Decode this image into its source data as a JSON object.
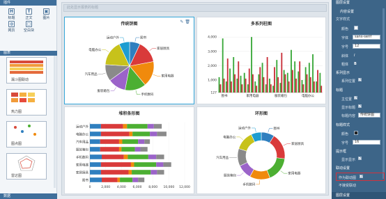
{
  "left_panel": {
    "top_label": "插件",
    "tools": [
      {
        "label": "标题",
        "icon": "H"
      },
      {
        "label": "正文",
        "icon": "T"
      },
      {
        "label": "图片",
        "icon": "▣"
      },
      {
        "label": "网页",
        "icon": "◍"
      },
      {
        "label": "空白块",
        "icon": "□"
      }
    ],
    "section_label": "图表",
    "thumbs": [
      "漏斗图联动",
      "热力图",
      "图点图",
      "雷达图"
    ],
    "bottom_label": "数据"
  },
  "canvas": {
    "title_placeholder": "此处显示报表的标题"
  },
  "right_panel": {
    "header": "图层设置",
    "tab": "内容设置",
    "section_text": "文字样式",
    "labels": {
      "color": "颜色",
      "font": "字体",
      "size": "字号",
      "italic": "斜体",
      "bold": "粗体",
      "series_show": "系列显示",
      "series_check": "系列位置",
      "title": "标题",
      "title_pos": "主位置",
      "title_show": "显示标题",
      "title_content": "标题内容",
      "legend_style": "标题样式",
      "legend_color": "颜色",
      "legend_size": "字号",
      "tooltip": "提示框",
      "tooltip_show": "显示显示",
      "link": "联动设置",
      "as_link": "作为联动图",
      "not_linked": "不接受联动"
    },
    "values": {
      "font": "sans-serif",
      "size": "12",
      "italic": "I",
      "bold": "B",
      "title_content": "传统饼图",
      "legend_size": "16"
    },
    "bottom": "图层设置"
  },
  "chart_data": [
    {
      "type": "pie",
      "title": "传统饼图",
      "categories": [
        "图书",
        "家居厨具",
        "家用电器",
        "手机数码",
        "服装箱包",
        "汽车用品",
        "电脑办公",
        "运动户外"
      ],
      "values": [
        7,
        15,
        17,
        14,
        12,
        11,
        17,
        7
      ],
      "colors": [
        "#2f7fbf",
        "#d93a3a",
        "#f08a0c",
        "#4caf32",
        "#9b63c9",
        "#8a8a8a",
        "#c7c21b",
        "#1d9dd1"
      ]
    },
    {
      "type": "bar",
      "title": "多系列柱图",
      "categories": [
        "图书",
        "家用电器",
        "服装箱包",
        "电脑办公"
      ],
      "yticks": [
        "4,000",
        "3,000",
        "2,000",
        "1,000",
        "127"
      ],
      "ylim": [
        127,
        4300
      ],
      "series": [
        {
          "values": [
            1200,
            3900,
            900,
            1800,
            2600,
            1100,
            1300,
            1500,
            700,
            4000,
            900,
            1400,
            2200,
            700,
            1100,
            600,
            2400,
            800,
            1700,
            1500,
            3100,
            2300,
            1600,
            1000,
            1900,
            2200,
            2800,
            900,
            1500
          ]
        },
        {
          "values": [
            700,
            1100,
            2500,
            900,
            1400,
            2300,
            700,
            1100,
            1800,
            1400,
            600,
            1900,
            1200,
            2600,
            700,
            1900,
            1200,
            2900,
            1400,
            900,
            1700,
            1100,
            2300,
            700,
            1400,
            1200,
            900,
            1700,
            600
          ]
        }
      ],
      "colors": [
        "#3aa83a",
        "#c9303a"
      ]
    },
    {
      "type": "bar",
      "title": "堆积条形图",
      "orientation": "horizontal",
      "stacked": true,
      "categories": [
        "运动户外",
        "电脑办公",
        "汽车用品",
        "服装箱包",
        "手机数码",
        "家用电器",
        "家居厨具",
        "图书"
      ],
      "xticks": [
        "0",
        "2,000",
        "4,000",
        "6,000",
        "8,000",
        "10,000",
        "12,000"
      ],
      "xlim": [
        0,
        12000
      ],
      "series": [
        {
          "values": [
            1400,
            1400,
            1300,
            1300,
            1500,
            1400,
            1400,
            1500
          ]
        },
        {
          "values": [
            2800,
            3600,
            2400,
            2400,
            2800,
            3800,
            3500,
            2000
          ]
        },
        {
          "values": [
            500,
            400,
            400,
            300,
            500,
            400,
            400,
            300
          ]
        },
        {
          "values": [
            2600,
            2200,
            2000,
            1700,
            2600,
            2800,
            2400,
            1600
          ]
        },
        {
          "values": [
            800,
            900,
            800,
            700,
            1000,
            900,
            800,
            700
          ]
        },
        {
          "values": [
            1000,
            1200,
            700,
            900,
            1000,
            1000,
            900,
            800
          ]
        }
      ],
      "colors": [
        "#2f7fbf",
        "#d93a3a",
        "#f08a0c",
        "#4caf32",
        "#9b63c9",
        "#8a8a8a"
      ]
    },
    {
      "type": "pie",
      "donut": true,
      "title": "环形图",
      "categories": [
        "图书",
        "家居厨具",
        "家用电器",
        "手机数码",
        "服装箱包",
        "汽车用品",
        "电脑办公",
        "运动户外"
      ],
      "values": [
        9,
        18,
        17,
        14,
        10,
        12,
        13,
        7
      ],
      "colors": [
        "#2f7fbf",
        "#d93a3a",
        "#4caf32",
        "#f08a0c",
        "#9b63c9",
        "#8a8a8a",
        "#c7c21b",
        "#1d9dd1"
      ]
    }
  ]
}
